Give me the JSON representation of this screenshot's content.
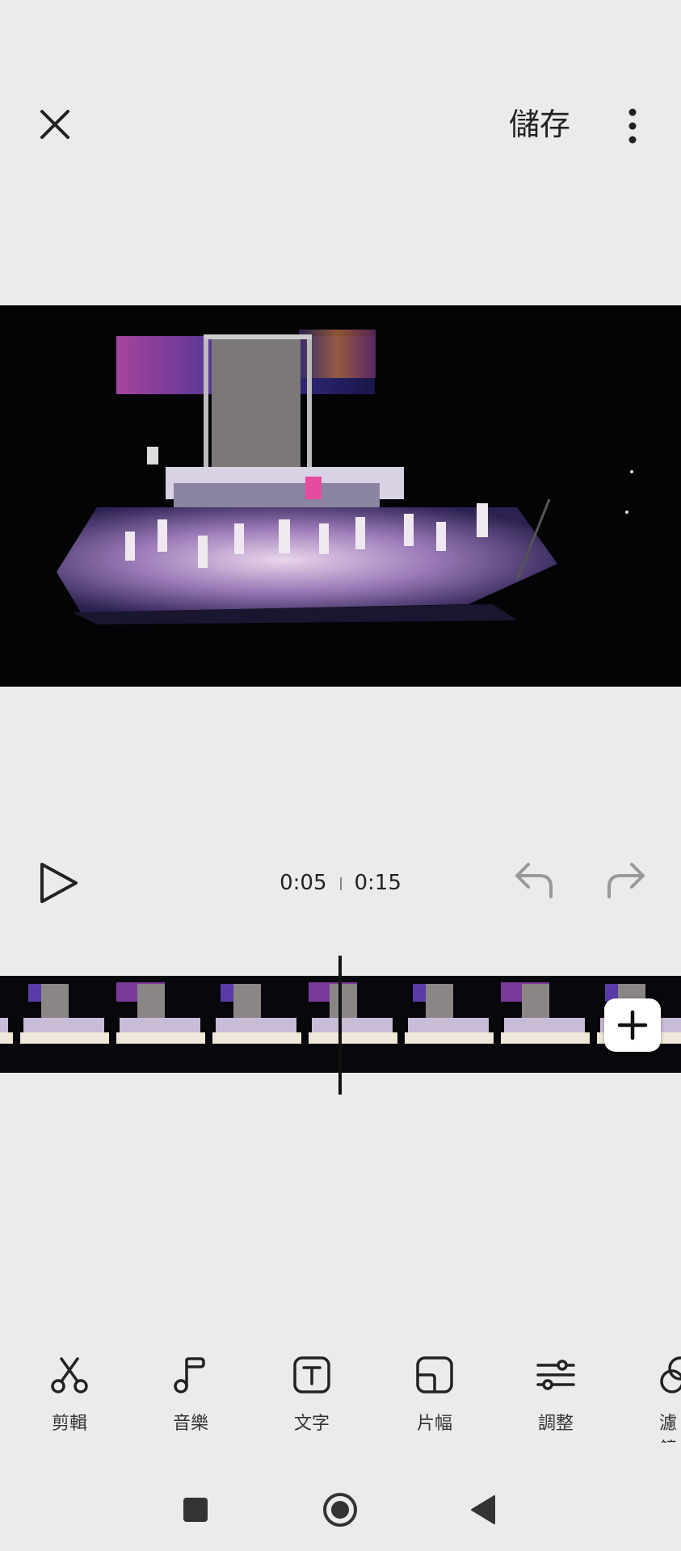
{
  "header": {
    "close_icon": "close-icon",
    "save_label": "儲存",
    "more_icon": "more-vertical-icon"
  },
  "player": {
    "current_time": "0:05",
    "total_time": "0:15"
  },
  "timeline": {
    "add_icon": "plus-icon"
  },
  "toolbar": {
    "items": [
      {
        "label": "剪輯",
        "icon": "scissors-icon"
      },
      {
        "label": "音樂",
        "icon": "music-note-icon"
      },
      {
        "label": "文字",
        "icon": "text-icon"
      },
      {
        "label": "片幅",
        "icon": "aspect-ratio-icon"
      },
      {
        "label": "調整",
        "icon": "sliders-icon"
      },
      {
        "label": "濾鏡",
        "icon": "filter-icon"
      }
    ]
  },
  "navbar": {
    "recents_icon": "recents-icon",
    "home_icon": "home-icon",
    "back_icon": "back-icon"
  }
}
